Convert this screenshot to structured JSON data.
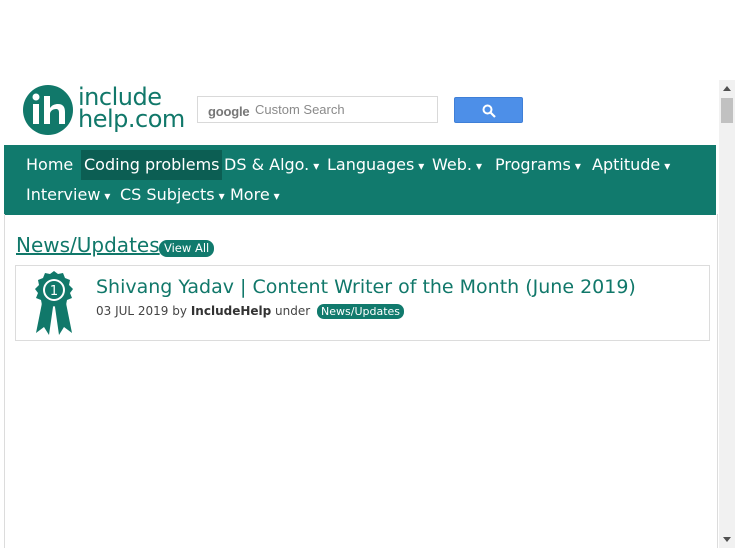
{
  "logo": {
    "line1": "include",
    "line2": "help.com"
  },
  "search": {
    "google_label": "google",
    "placeholder": "Custom Search"
  },
  "nav": {
    "items": [
      {
        "label": "Home",
        "arrow": ""
      },
      {
        "label": "Coding problems",
        "arrow": ""
      },
      {
        "label": "DS & Algo.",
        "arrow": "▾"
      },
      {
        "label": "Languages",
        "arrow": "▾"
      },
      {
        "label": "Web.",
        "arrow": "▾"
      },
      {
        "label": "Programs",
        "arrow": "▾"
      },
      {
        "label": "Aptitude",
        "arrow": "▾"
      },
      {
        "label": "Interview",
        "arrow": "▾"
      },
      {
        "label": "CS Subjects",
        "arrow": "▾"
      },
      {
        "label": "More",
        "arrow": "▾"
      }
    ]
  },
  "section": {
    "title": "News/Updates",
    "view_all": "View All"
  },
  "articles": [
    {
      "title": "Shivang Yadav | Content Writer of the Month (June 2019)",
      "date": "03 JUL 2019",
      "by": "by",
      "author": "IncludeHelp",
      "under": "under",
      "category": "News/Updates",
      "badge_number": "1"
    }
  ],
  "colors": {
    "brand": "#117a6d",
    "nav_active": "#0c5e53",
    "search_button": "#4d8fe8"
  }
}
